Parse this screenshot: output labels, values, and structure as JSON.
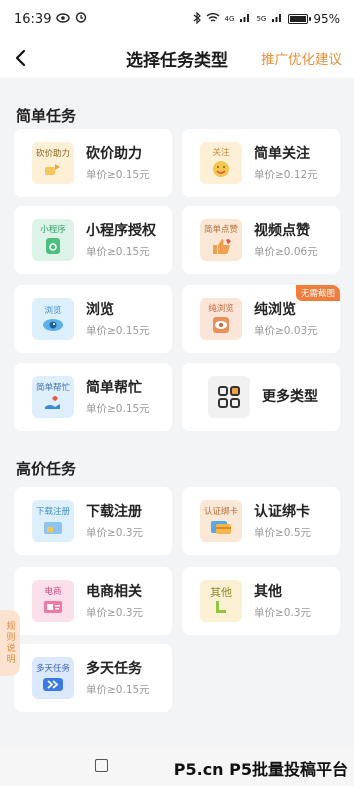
{
  "status": {
    "time": "16:39",
    "battery": "95%",
    "battery_level": 0.95,
    "signal_4g": "4G",
    "signal_5g": "5G"
  },
  "header": {
    "title": "选择任务类型",
    "action": "推广优化建议"
  },
  "simple": {
    "title": "简单任务",
    "cards": [
      {
        "icon_label": "砍价助力",
        "name": "砍价助力",
        "price": "单价≥0.15元"
      },
      {
        "icon_label": "关注",
        "name": "简单关注",
        "price": "单价≥0.12元"
      },
      {
        "icon_label": "小程序",
        "name": "小程序授权",
        "price": "单价≥0.15元"
      },
      {
        "icon_label": "简单点赞",
        "name": "视频点赞",
        "price": "单价≥0.06元"
      },
      {
        "icon_label": "浏览",
        "name": "浏览",
        "price": "单价≥0.15元"
      },
      {
        "icon_label": "纯浏览",
        "name": "纯浏览",
        "price": "单价≥0.03元",
        "badge": "无需截图"
      },
      {
        "icon_label": "简单帮忙",
        "name": "简单帮忙",
        "price": "单价≥0.15元"
      },
      {
        "name": "更多类型"
      }
    ]
  },
  "premium": {
    "title": "高价任务",
    "cards": [
      {
        "icon_label": "下载注册",
        "name": "下载注册",
        "price": "单价≥0.3元"
      },
      {
        "icon_label": "认证绑卡",
        "name": "认证绑卡",
        "price": "单价≥0.5元"
      },
      {
        "icon_label": "电商",
        "name": "电商相关",
        "price": "单价≥0.3元"
      },
      {
        "icon_label": "其他",
        "name": "其他",
        "price": "单价≥0.3元"
      },
      {
        "icon_label": "多天任务",
        "name": "多天任务",
        "price": "单价≥0.15元"
      }
    ]
  },
  "side_tab": "规则说明",
  "watermark": "P5.cn P5批量投稿平台",
  "colors": {
    "accent": "#e8903a",
    "ribbon": "#f07d3c"
  }
}
